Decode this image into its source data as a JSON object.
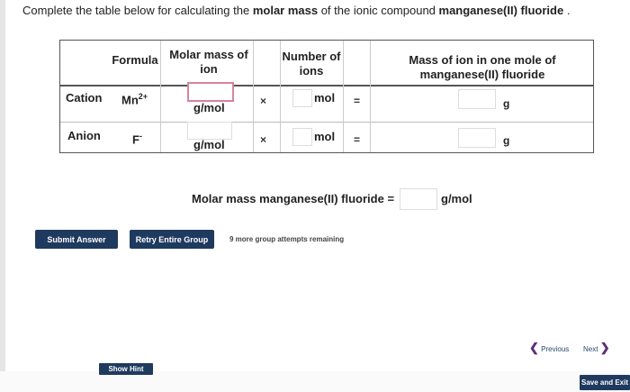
{
  "question": {
    "prefix": "Complete the table below for calculating the ",
    "bold1": "molar mass",
    "middle": " of the ionic compound ",
    "bold2": "manganese(II) fluoride",
    "suffix": " ."
  },
  "table": {
    "headers": {
      "formula": "Formula",
      "molar_mass_line1": "Molar mass of",
      "molar_mass_line2": "ion",
      "number_line1": "Number of",
      "number_line2": "ions",
      "mass_line1": "Mass of ion in one mole of",
      "mass_line2": "manganese(II) fluoride"
    },
    "rows": [
      {
        "label": "Cation",
        "formula": "Mn",
        "charge": "2+",
        "molar_unit": "g/mol",
        "times": "×",
        "count_unit": "mol",
        "equals": "=",
        "mass_unit": "g"
      },
      {
        "label": "Anion",
        "formula": "F",
        "charge": "-",
        "molar_unit": "g/mol",
        "times": "×",
        "count_unit": "mol",
        "equals": "=",
        "mass_unit": "g"
      }
    ]
  },
  "total": {
    "label": "Molar mass manganese(II) fluoride =",
    "unit": "g/mol"
  },
  "buttons": {
    "submit": "Submit Answer",
    "retry": "Retry Entire Group",
    "remaining": "9 more group attempts remaining",
    "hint": "Show Hint",
    "save_exit": "Save and Exit"
  },
  "nav": {
    "previous": "Previous",
    "next": "Next"
  }
}
